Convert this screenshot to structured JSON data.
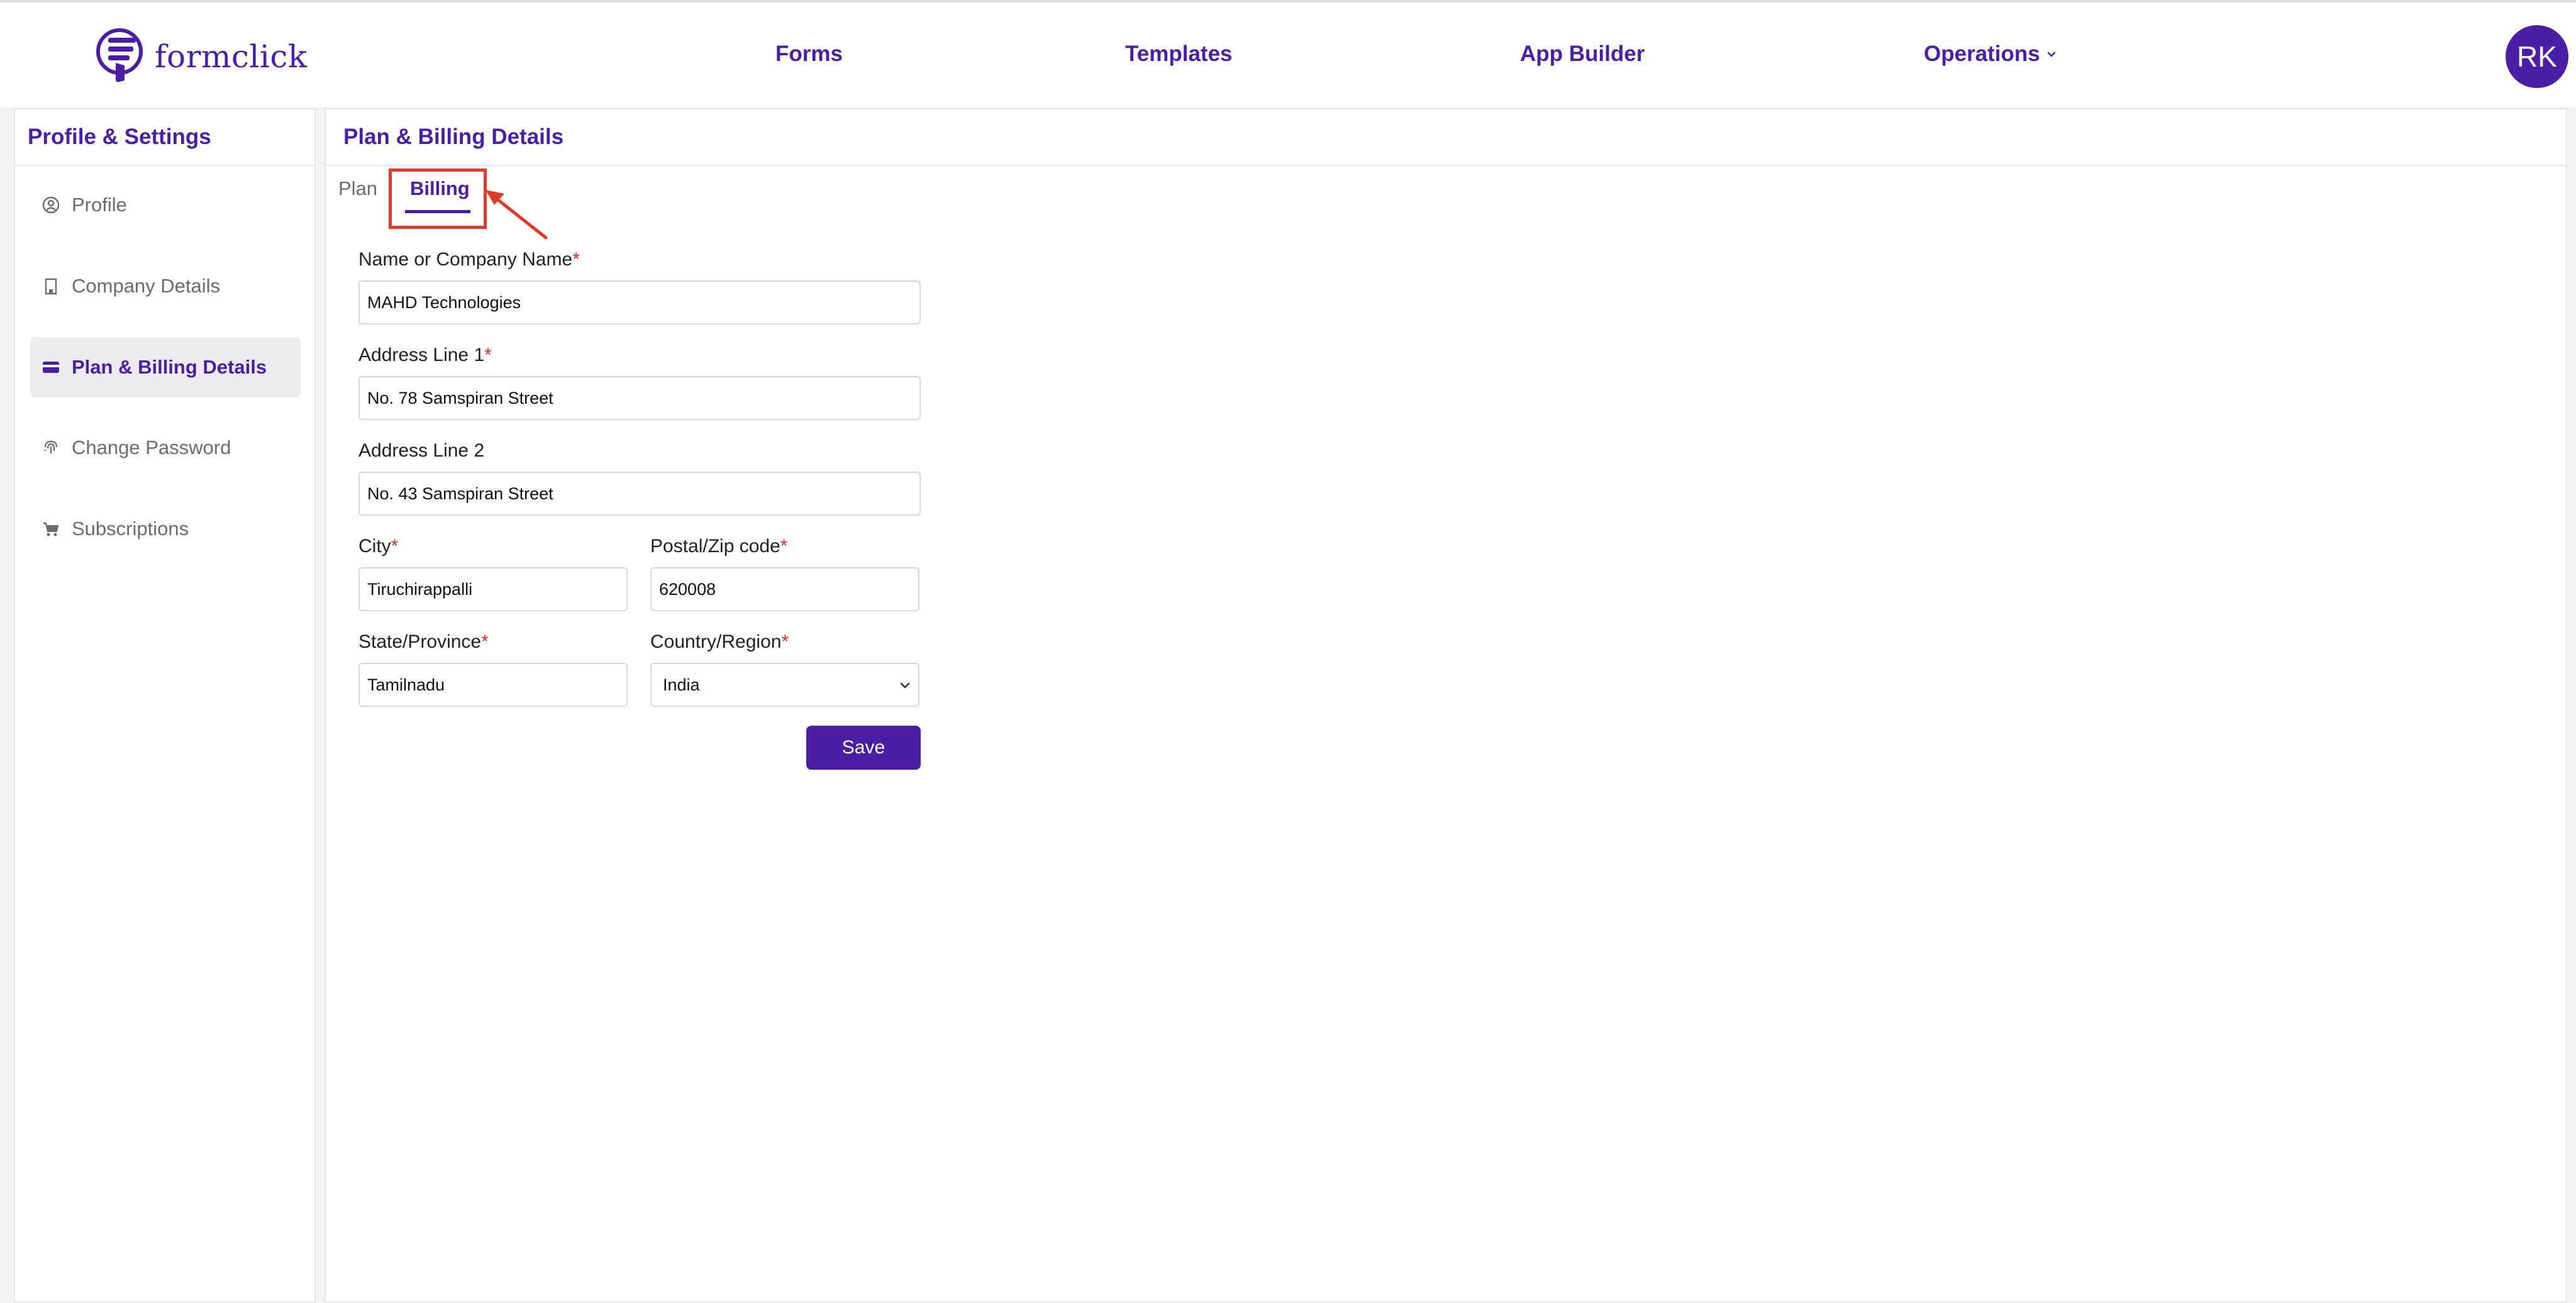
{
  "app": {
    "brand_name": "formclick",
    "avatar_initials": "RK"
  },
  "nav": {
    "forms": "Forms",
    "templates": "Templates",
    "app_builder": "App Builder",
    "operations": "Operations"
  },
  "sidebar": {
    "title": "Profile & Settings",
    "items": [
      {
        "label": "Profile",
        "icon": "user-circle-icon"
      },
      {
        "label": "Company Details",
        "icon": "building-icon"
      },
      {
        "label": "Plan & Billing Details",
        "icon": "credit-card-icon",
        "active": true
      },
      {
        "label": "Change Password",
        "icon": "fingerprint-icon"
      },
      {
        "label": "Subscriptions",
        "icon": "cart-icon"
      }
    ]
  },
  "main": {
    "title": "Plan & Billing Details",
    "tabs": [
      {
        "label": "Plan"
      },
      {
        "label": "Billing",
        "active": true
      }
    ]
  },
  "form": {
    "name": {
      "label": "Name or Company Name",
      "value": "MAHD Technologies"
    },
    "address1": {
      "label": "Address Line 1",
      "value": "No. 78 Samspiran Street"
    },
    "address2": {
      "label": "Address Line 2",
      "value": "No. 43 Samspiran Street"
    },
    "city": {
      "label": "City",
      "value": "Tiruchirappalli"
    },
    "postal": {
      "label": "Postal/Zip code",
      "value": "620008"
    },
    "state": {
      "label": "State/Province",
      "value": "Tamilnadu"
    },
    "country": {
      "label": "Country/Region",
      "value": "India"
    },
    "required_marker": "*",
    "save_label": "Save"
  },
  "colors": {
    "brand": "#4b1fa5",
    "required": "#e0302a",
    "annotation": "#e03a28"
  }
}
